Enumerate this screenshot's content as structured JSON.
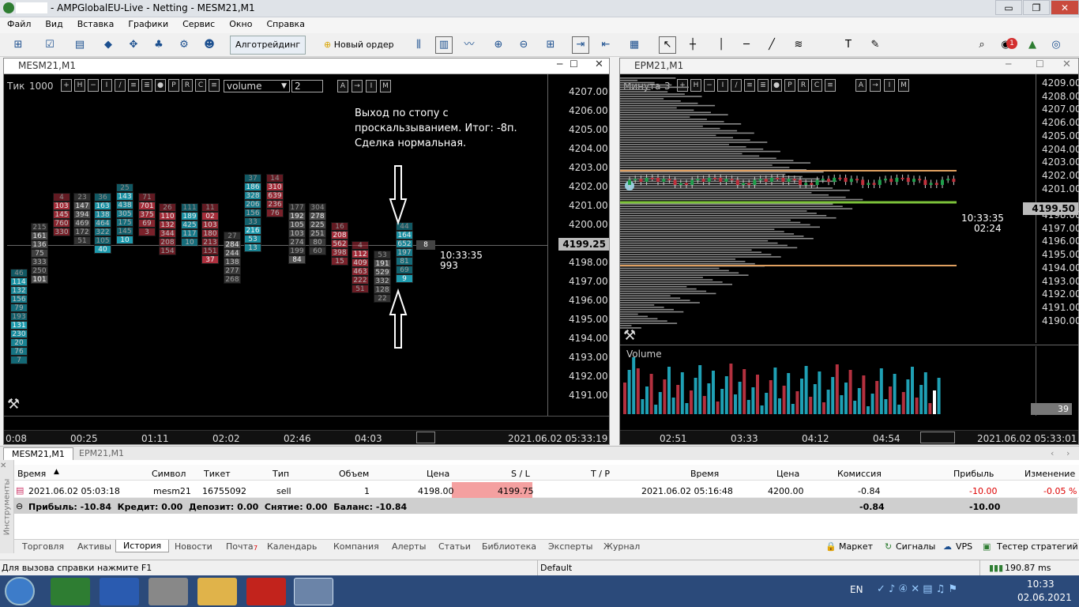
{
  "window": {
    "title": "- AMPGlobalEU-Live - Netting - MESM21,M1"
  },
  "menu": [
    "Файл",
    "Вид",
    "Вставка",
    "Графики",
    "Сервис",
    "Окно",
    "Справка"
  ],
  "toolbar": {
    "algo": "Алготрейдинг",
    "new_order": "Новый ордер",
    "notif_count": "1"
  },
  "chart1": {
    "title": "MESM21,M1",
    "mode": "Тик",
    "ticks": "1000",
    "indicator": "volume",
    "value": "2",
    "prices": [
      "4207.00",
      "4206.00",
      "4205.00",
      "4204.00",
      "4203.00",
      "4202.00",
      "4201.00",
      "4200.00",
      "4199.25",
      "4198.00",
      "4197.00",
      "4196.00",
      "4195.00",
      "4194.00",
      "4193.00",
      "4192.00",
      "4191.00"
    ],
    "current_price": "4199.25",
    "times": [
      "0:08",
      "00:25",
      "01:11",
      "02:02",
      "02:46",
      "04:03"
    ],
    "datetime": "2021.06.02 05:33:19",
    "timer": "10:33:35",
    "timer_vol": "993",
    "note": [
      "Выход по стопу с",
      "проскальзыванием. Итог: -8п.",
      "Сделка нормальная."
    ],
    "cluster_last": "8"
  },
  "chart2": {
    "title": "EPM21,M1",
    "mode": "Минута",
    "value": "3",
    "prices": [
      "4209.00",
      "4208.00",
      "4207.00",
      "4206.00",
      "4205.00",
      "4204.00",
      "4203.00",
      "4202.00",
      "4201.00",
      "4199.50",
      "4198.00",
      "4197.00",
      "4196.00",
      "4195.00",
      "4194.00",
      "4193.00",
      "4192.00",
      "4191.00",
      "4190.00"
    ],
    "current_price": "4199.50",
    "timer": "10:33:35",
    "timer2": "02:24",
    "volume_label": "Volume",
    "volume_value": "39",
    "times": [
      "02:51",
      "03:33",
      "04:12",
      "04:54"
    ],
    "datetime": "2021.06.02 05:33:01"
  },
  "chart_tabs": [
    "MESM21,M1",
    "EPM21,M1"
  ],
  "history": {
    "headers": [
      "Время",
      "Символ",
      "Тикет",
      "Тип",
      "Объем",
      "Цена",
      "S / L",
      "T / P",
      "Время",
      "Цена",
      "Комиссия",
      "Прибыль",
      "Изменение"
    ],
    "row": [
      "2021.06.02 05:03:18",
      "mesm21",
      "16755092",
      "sell",
      "1",
      "4198.00",
      "4199.75",
      "",
      "2021.06.02 05:16:48",
      "4200.00",
      "-0.84",
      "-10.00",
      "-0.05 %"
    ],
    "summary": "Прибыль: -10.84  Кредит: 0.00  Депозит: 0.00  Снятие: 0.00  Баланс: -10.84",
    "summary_comm": "-0.84",
    "summary_profit": "-10.00",
    "side_label": "Инструменты"
  },
  "toolbox_tabs": [
    "Торговля",
    "Активы",
    "История",
    "Новости",
    "Почта",
    "Календарь",
    "Компания",
    "Алерты",
    "Статьи",
    "Библиотека",
    "Эксперты",
    "Журнал"
  ],
  "mail_count": "7",
  "toolbox_right": [
    "Маркет",
    "Сигналы",
    "VPS",
    "Тестер стратегий"
  ],
  "status": {
    "help": "Для вызова справки нажмите F1",
    "profile": "Default",
    "ping": "190.87 ms"
  },
  "taskbar": {
    "lang": "EN",
    "time": "10:33",
    "date": "02.06.2021"
  },
  "colors": {
    "buy_cell": "#1fa0b4",
    "sell_cell": "#b3313f",
    "neutral_cell": "#555555",
    "vol_up": "#1fa0b4",
    "vol_down": "#b3313f"
  }
}
